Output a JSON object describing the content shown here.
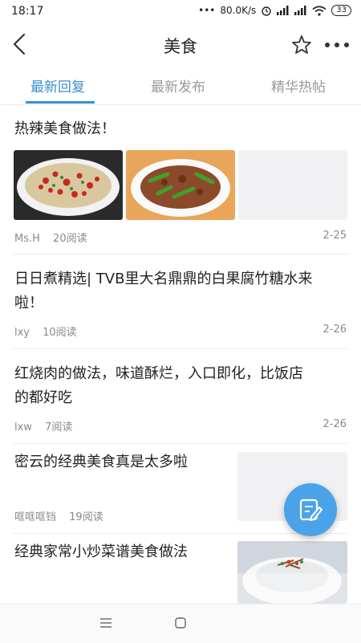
{
  "status_bar": {
    "time": "18:17",
    "network_speed": "80.0K/s",
    "battery": "33"
  },
  "header": {
    "title": "美食"
  },
  "tabs": [
    {
      "label": "最新回复",
      "active": true
    },
    {
      "label": "最新发布",
      "active": false
    },
    {
      "label": "精华热帖",
      "active": false
    }
  ],
  "posts": [
    {
      "title": "热辣美食做法！",
      "author": "Ms.H",
      "reads": "20阅读",
      "date": "2-25"
    },
    {
      "title_line1": "日日煮精选| TVB里大名鼎鼎的白果腐竹糖水来",
      "title_line2": "啦！",
      "author": "lxy",
      "reads": "10阅读",
      "date": "2-26"
    },
    {
      "title_line1": "红烧肉的做法，味道酥烂，入口即化，比饭店",
      "title_line2": "的都好吃",
      "author": "lxw",
      "reads": "7阅读",
      "date": "2-26"
    },
    {
      "title": "密云的经典美食真是太多啦",
      "author": "哐哐哐铛",
      "reads": "19阅读"
    },
    {
      "title": "经典家常小炒菜谱美食做法"
    }
  ],
  "colors": {
    "accent": "#3b8fd0",
    "fab": "#4aa3e8"
  }
}
